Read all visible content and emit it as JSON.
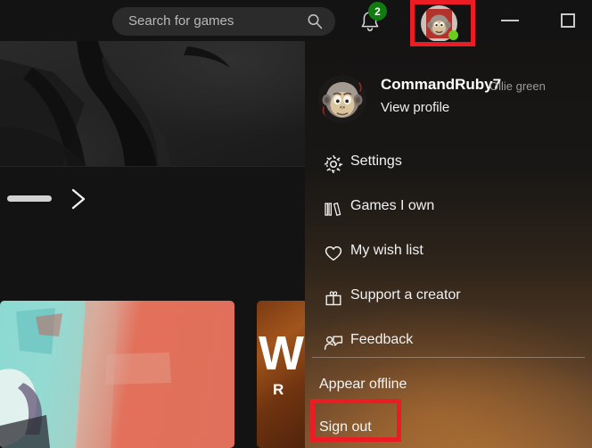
{
  "window": {
    "minimize_icon": "minimize-icon",
    "maximize_icon": "maximize-icon"
  },
  "search": {
    "placeholder": "Search for games",
    "icon": "search-icon"
  },
  "notifications": {
    "icon": "bell-icon",
    "count": "2",
    "badge_color": "#107c10"
  },
  "account_button": {
    "icon": "avatar",
    "presence": "online",
    "presence_color": "#6ccd1e"
  },
  "highlights": {
    "color": "#ec1c24",
    "avatar_target": "account-avatar",
    "signout_target": "sign-out"
  },
  "dropdown": {
    "profile": {
      "display_name": "CommandRuby7",
      "gamertag": "Ollie green",
      "view_profile": "View profile",
      "avatar_icon": "avatar"
    },
    "items": [
      {
        "label": "Settings",
        "icon": "gear-icon"
      },
      {
        "label": "Games I own",
        "icon": "books-icon"
      },
      {
        "label": "My wish list",
        "icon": "heart-icon"
      },
      {
        "label": "Support a creator",
        "icon": "gift-icon"
      },
      {
        "label": "Feedback",
        "icon": "feedback-icon"
      }
    ],
    "footer_items": [
      {
        "label": "Appear offline"
      },
      {
        "label": "Sign out"
      }
    ]
  },
  "background": {
    "carousel_next_icon": "chevron-right-icon",
    "cards": [
      {
        "name": "game-card-1"
      },
      {
        "name": "game-card-2",
        "title_initial": "W",
        "subtitle_initial": "R"
      }
    ]
  }
}
